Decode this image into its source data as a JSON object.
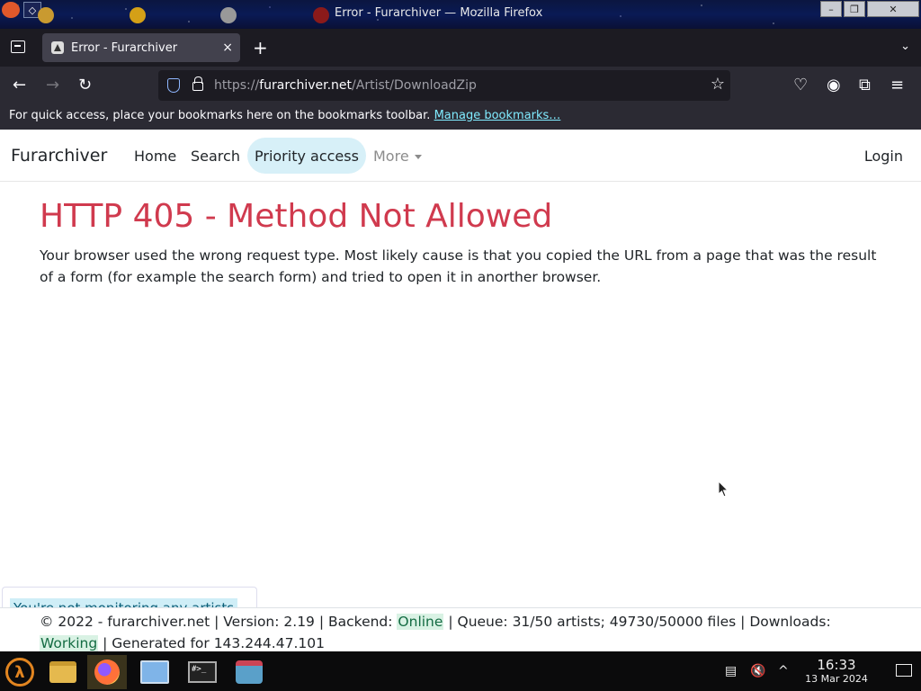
{
  "window": {
    "title": "Error - Furarchiver — Mozilla Firefox"
  },
  "tabs": [
    {
      "label": "Error - Furarchiver",
      "close": "×"
    }
  ],
  "tabbar": {
    "new_tab": "+",
    "overflow": "⌄"
  },
  "navbar": {
    "back": "←",
    "forward": "→",
    "reload": "↻",
    "url_prefix": "https://",
    "url_host": "furarchiver.net",
    "url_path": "/Artist/DownloadZip",
    "bookmark_star": "☆",
    "pocket": "♡",
    "account": "◉",
    "extensions": "⧉",
    "menu": "≡"
  },
  "bookmarks_toolbar": {
    "text": "For quick access, place your bookmarks here on the bookmarks toolbar.",
    "link": "Manage bookmarks…"
  },
  "site": {
    "brand": "Furarchiver",
    "nav": [
      {
        "label": "Home"
      },
      {
        "label": "Search"
      },
      {
        "label": "Priority access"
      },
      {
        "label": "More"
      }
    ],
    "login": "Login"
  },
  "error": {
    "title": "HTTP 405 - Method Not Allowed",
    "message": "Your browser used the wrong request type. Most likely cause is that you copied the URL from a page that was the result of a form (for example the search form) and tried to open it in anorther browser."
  },
  "toast": {
    "text": "You're not monitoring any artists"
  },
  "footer": {
    "part1": "© 2022 - furarchiver.net | Version: 2.19 | Backend: ",
    "backend_status": "Online",
    "part2": " | Queue: 31/50 artists; 49730/50000 files | Downloads: ",
    "downloads_status": "Working",
    "part3": " | Generated for 143.244.47.101"
  },
  "taskbar": {
    "terminal_text": "#>_",
    "clock_time": "16:33",
    "clock_date": "13 Mar 2024",
    "tray_clipboard": "▤",
    "tray_volume": "🔇",
    "tray_expand": "^"
  },
  "colors": {
    "error_red": "#d03a4e",
    "active_nav_bg": "#d7f0f8",
    "status_green_bg": "#d9f2e4"
  }
}
